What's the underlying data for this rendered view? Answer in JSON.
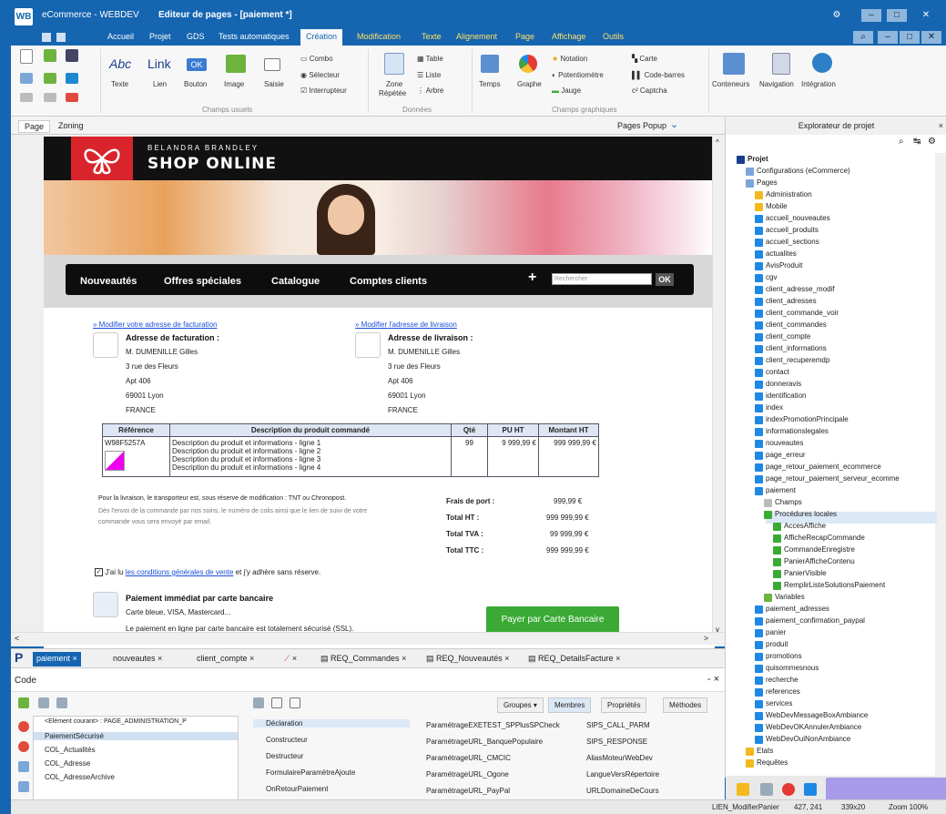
{
  "app": {
    "logo": "WB",
    "title": "eCommerce - WEBDEV",
    "document_title": "Editeur de pages - [paiement *]"
  },
  "menu": [
    "Accueil",
    "Projet",
    "GDS",
    "Tests automatiques",
    "Création",
    "Modification",
    "Texte",
    "Alignement",
    "Page",
    "Affichage",
    "Outils"
  ],
  "ribbon": {
    "champs_usuels": {
      "group": "Champs usuels",
      "items": [
        "Texte",
        "Lien",
        "Bouton",
        "Image",
        "Saisie"
      ],
      "icon_labels": {
        "texte": "Abc",
        "lien": "Link",
        "bouton": "OK"
      },
      "small": [
        "Combo",
        "Sélecteur",
        "Interrupteur"
      ]
    },
    "donnees": {
      "group": "Données",
      "zone": [
        "Zone",
        "Répétée"
      ],
      "small": [
        "Table",
        "Liste",
        "Arbre"
      ]
    },
    "graphiques": {
      "group": "Champs graphiques",
      "items": [
        "Temps",
        "Graphe"
      ],
      "small": [
        "Notation",
        "Potentiomètre",
        "Jauge",
        "Carte",
        "Code-barres",
        "Captcha"
      ]
    },
    "conteneurs": [
      "Conteneurs",
      "Navigation",
      "Intégration"
    ]
  },
  "editor": {
    "tabs": [
      "Page",
      "Zoning"
    ],
    "popup_tab": "Pages Popup"
  },
  "shop": {
    "brand_top": "BELANDRA BRANDLEY",
    "brand_main": "SHOP ONLINE",
    "nav": [
      "Nouveautés",
      "Offres spéciales",
      "Catalogue",
      "Comptes clients"
    ],
    "nav_plus": "+",
    "search_placeholder": "Rechercher",
    "search_button": "OK",
    "billing": {
      "link": "» Modifier votre adresse de facturation",
      "title": "Adresse de facturation :",
      "lines": [
        "M. DUMENILLE Gilles",
        "3 rue des Fleurs",
        "Apt 406",
        "69001 Lyon",
        "FRANCE"
      ]
    },
    "shipping": {
      "link": "» Modifier l'adresse de livraison",
      "title": "Adresse de livraison :",
      "lines": [
        "M. DUMENILLE Gilles",
        "3 rue des Fleurs",
        "Apt 406",
        "69001 Lyon",
        "FRANCE"
      ]
    },
    "table": {
      "headers": [
        "Référence",
        "Description du produit commandé",
        "Qté",
        "PU HT",
        "Montant HT"
      ],
      "ref": "W98F5257A",
      "desc": [
        "Description du produit et informations - ligne 1",
        "Description du produit et informations - ligne 2",
        "Description du produit et informations - ligne 3",
        "Description du produit et informations - ligne 4"
      ],
      "qty": "99",
      "pu": "9 999,99 €",
      "montant": "999 999,99 €"
    },
    "notice1": "Pour la livraison, le transporteur est, sous réserve de modification : TNT ou Chronopost.",
    "notice2": "Dès l'envoi de la commande par nos soins, le numéro de colis ainsi que le lien de suivi de votre",
    "notice3": "commande vous sera envoyé par email.",
    "totals": [
      {
        "label": "Frais de port :",
        "value": "999,99 €"
      },
      {
        "label": "Total HT :",
        "value": "999 999,99 €"
      },
      {
        "label": "Total TVA :",
        "value": "99 999,99 €"
      },
      {
        "label": "Total TTC :",
        "value": "999 999,99 €"
      }
    ],
    "cgv_pre": "J'ai lu",
    "cgv_link": "les conditions générales de vente",
    "cgv_post": "et j'y adhère sans réserve.",
    "payment_title": "Paiement immédiat par carte bancaire",
    "payment_cards": "Carte bleue, VISA, Mastercard...",
    "payment_note": "Le paiement en ligne par carte bancaire est totalement sécurisé (SSL).",
    "pay_button": "Payer par Carte Bancaire"
  },
  "file_tabs": [
    "paiement",
    "nouveautes",
    "client_compte",
    "",
    "REQ_Commandes",
    "REQ_Nouveautés",
    "REQ_DetailsFacture"
  ],
  "code": {
    "title": "Code",
    "close": "- ×",
    "left_items": [
      "<Elément courant> : PAGE_ADMINISTRATION_P",
      "PaiementSécurisé",
      "COL_Actualités",
      "COL_Adresse",
      "COL_AdresseArchive"
    ],
    "buttons": [
      "Groupes",
      "Membres",
      "Propriétés",
      "Méthodes"
    ],
    "col1": [
      "Déclaration",
      "Constructeur",
      "Destructeur",
      "FormulaireParamètreAjoute",
      "OnRetourPaiement"
    ],
    "col2": [
      "ParamétrageEXETEST_SPPlusSPCheck",
      "ParamétrageURL_BanquePopulaire",
      "ParamétrageURL_CMCIC",
      "ParamétrageURL_Ogone",
      "ParamétrageURL_PayPal"
    ],
    "col3": [
      "SIPS_CALL_PARM",
      "SIPS_RESPONSE",
      "AliasMoteurWebDev",
      "LangueVersRépertoire",
      "URLDomaineDeCours"
    ]
  },
  "explorer": {
    "title": "Explorateur de projet",
    "root": "Projet",
    "config": "Configurations (eCommerce)",
    "pages": "Pages",
    "folders": [
      "Administration",
      "Mobile"
    ],
    "items_a": [
      "accueil_nouveautes",
      "accueil_produits",
      "accueil_sections",
      "actualites",
      "AvisProduit",
      "cgv",
      "client_adresse_modif",
      "client_adresses",
      "client_commande_voir",
      "client_commandes",
      "client_compte",
      "client_informations",
      "client_recuperemdp",
      "contact",
      "donneravis",
      "identification",
      "index",
      "indexPromotionPrincipale",
      "informationslegales",
      "nouveautes",
      "page_erreur",
      "page_retour_paiement_ecommerce",
      "page_retour_paiement_serveur_ecomme"
    ],
    "paiement": "paiement",
    "champs": "Champs",
    "proc_locales": "Procédures locales",
    "procs": [
      "AccesAffiche",
      "AfficheRecapCommande",
      "CommandeEnregistre",
      "PanierAfficheContenu",
      "PanierVisible",
      "RemplirListeSolutionsPaiement"
    ],
    "variables": "Variables",
    "items_b": [
      "paiement_adresses",
      "paiement_confirmation_paypal",
      "panier",
      "produit",
      "promotions",
      "quisommesnous",
      "recherche",
      "references",
      "services",
      "WebDevMessageBoxAmbiance",
      "WebDevOKAnnulerAmbiance",
      "WebDevOuiNonAmbiance"
    ],
    "etats": "Etats",
    "requetes": "Requêtes"
  },
  "status": {
    "element": "LIEN_ModifierPanier",
    "position": "427, 241",
    "size": "339x20",
    "zoom": "Zoom 100%"
  },
  "colors": {
    "chrome_blue": "#1565b0",
    "accent_red": "#d9242c",
    "pay_green": "#3aaa35",
    "link_blue": "#1a4fd6"
  }
}
